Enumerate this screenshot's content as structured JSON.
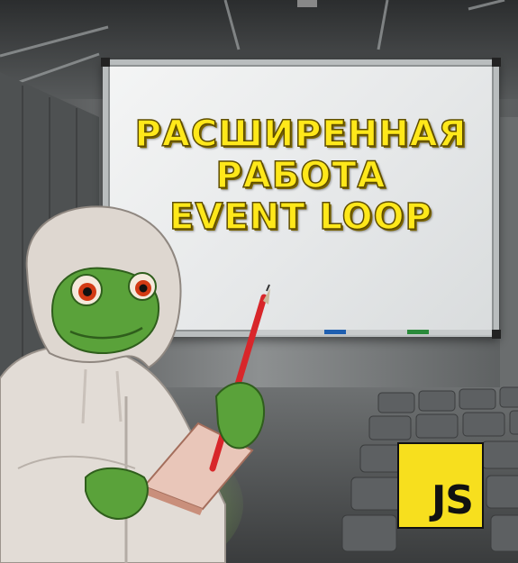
{
  "headline": {
    "line1": "РАСШИРЕННАЯ",
    "line2": "РАБОТА",
    "line3": "EVENT LOOP"
  },
  "badge": {
    "label": "JS"
  },
  "colors": {
    "headline": "#ffe81a",
    "badge_bg": "#f7df1e",
    "hoodie": "#e2dcd6",
    "frog": "#5aa23a",
    "pen": "#d8262a"
  },
  "icons": [
    "whiteboard",
    "frog-mascot",
    "hoodie",
    "pen",
    "notebook",
    "js-logo"
  ]
}
